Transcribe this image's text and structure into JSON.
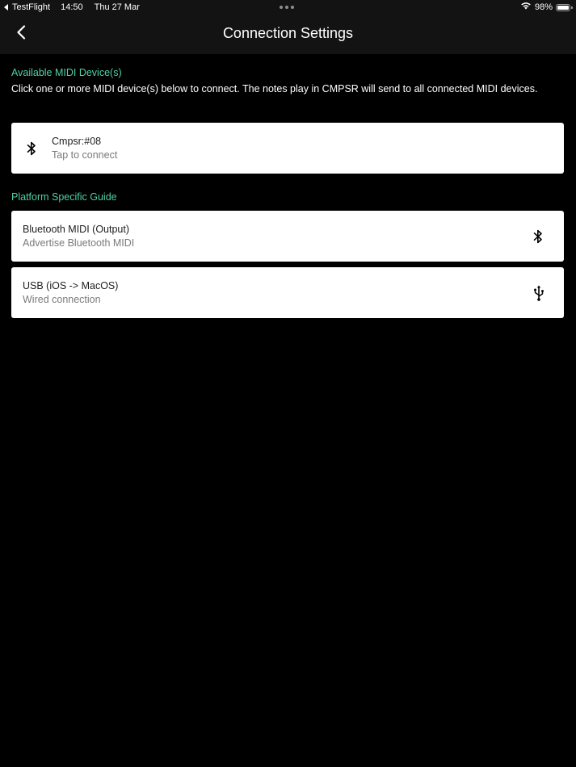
{
  "status_bar": {
    "app": "TestFlight",
    "time": "14:50",
    "date": "Thu 27 Mar",
    "battery": "98%",
    "battery_level": 0.98
  },
  "nav": {
    "title": "Connection Settings",
    "back_icon": "chevron-left-icon"
  },
  "devices_section": {
    "header": "Available MIDI Device(s)",
    "description": "Click one or more MIDI device(s) below to connect. The notes play in CMPSR will send to all connected MIDI devices.",
    "devices": [
      {
        "name": "Cmpsr:#08",
        "status": "Tap to connect",
        "icon": "bluetooth-icon"
      }
    ]
  },
  "guide_section": {
    "header": "Platform Specific Guide",
    "items": [
      {
        "title": "Bluetooth MIDI (Output)",
        "subtitle": "Advertise Bluetooth MIDI",
        "icon": "bluetooth-icon"
      },
      {
        "title": "USB (iOS -> MacOS)",
        "subtitle": "Wired connection",
        "icon": "usb-icon"
      }
    ]
  },
  "colors": {
    "background": "#000000",
    "bar": "#131313",
    "accent": "#4fd1a5",
    "card": "#ffffff",
    "card_title": "#1e1e1e",
    "card_subtitle": "#7a7a7a"
  }
}
